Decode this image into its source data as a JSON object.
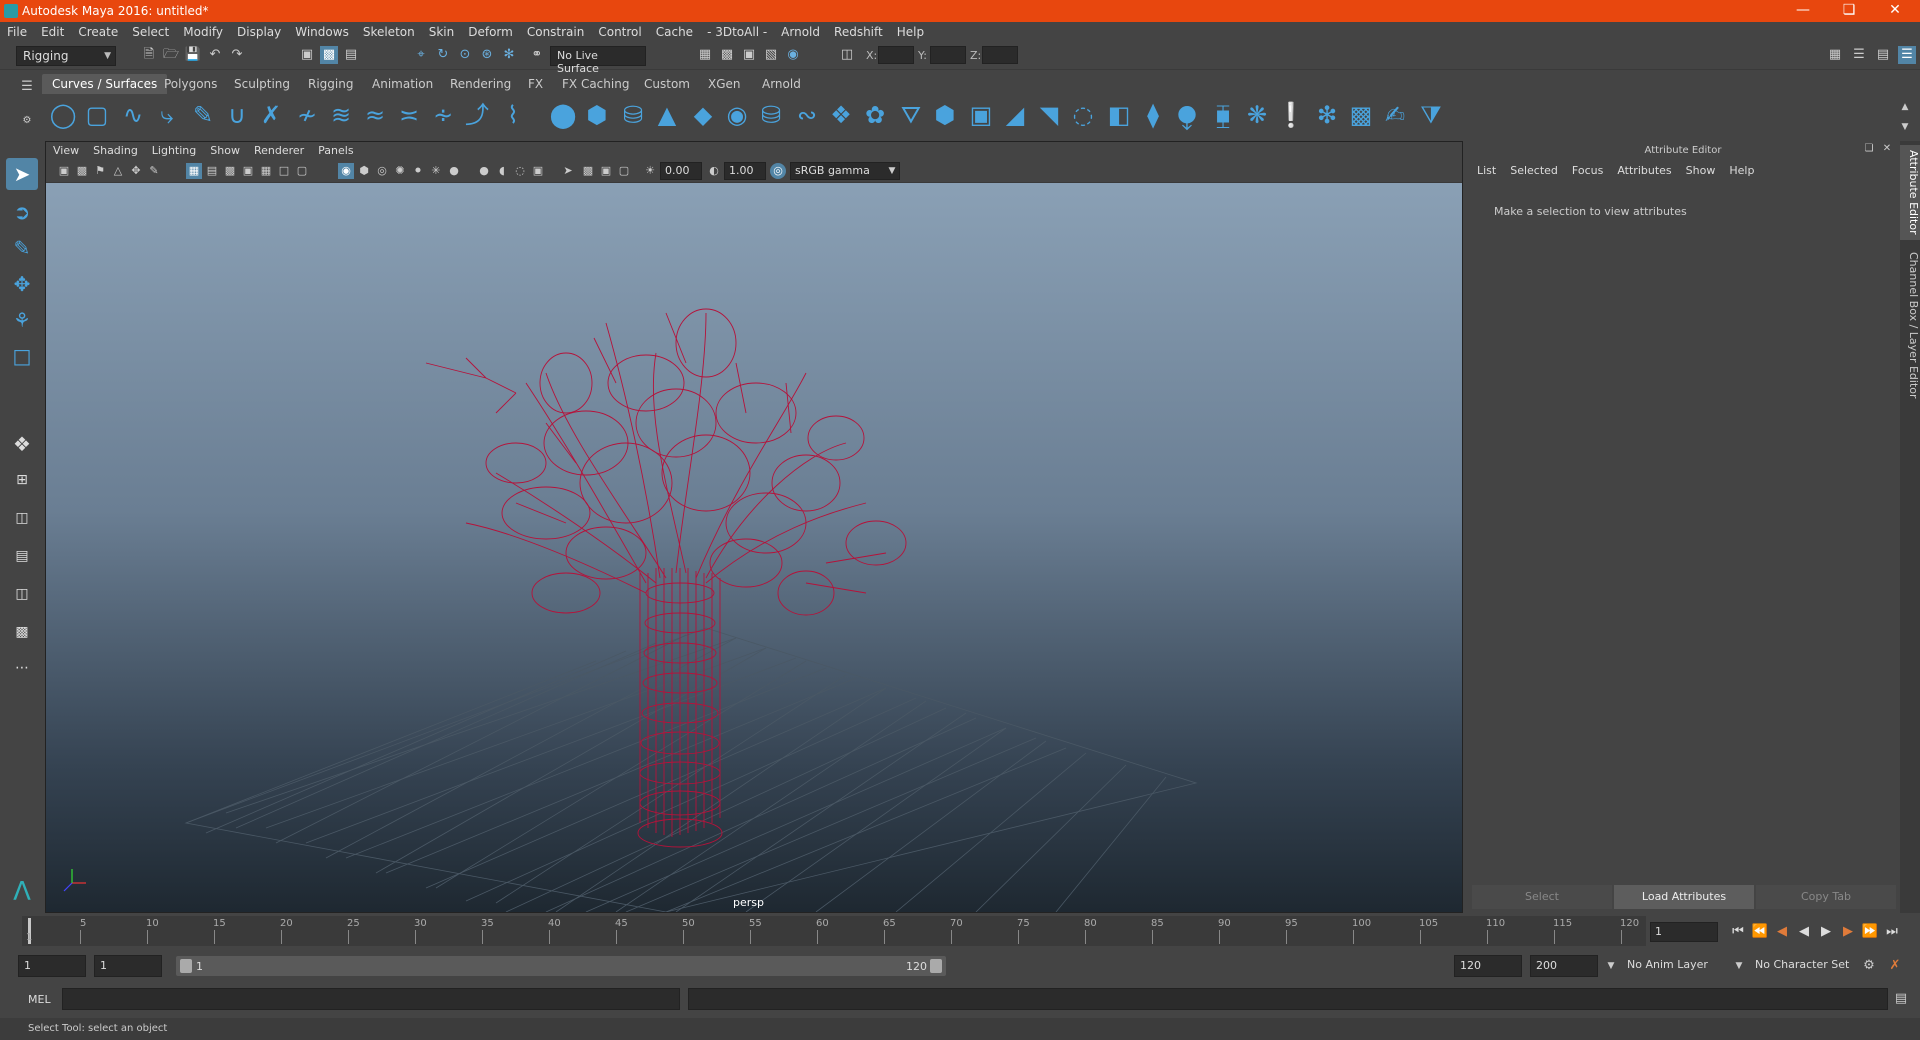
{
  "window": {
    "title": "Autodesk Maya 2016: untitled*"
  },
  "menubar": [
    "File",
    "Edit",
    "Create",
    "Select",
    "Modify",
    "Display",
    "Windows",
    "Skeleton",
    "Skin",
    "Deform",
    "Constrain",
    "Control",
    "Cache",
    "- 3DtoAll -",
    "Arnold",
    "Redshift",
    "Help"
  ],
  "statusline": {
    "menuset": "Rigging",
    "live_surface": "No Live Surface",
    "x_label": "X:",
    "y_label": "Y:",
    "z_label": "Z:"
  },
  "shelf_tabs": [
    "Curves / Surfaces",
    "Polygons",
    "Sculpting",
    "Rigging",
    "Animation",
    "Rendering",
    "FX",
    "FX Caching",
    "Custom",
    "XGen",
    "Arnold"
  ],
  "shelf_active": "Curves / Surfaces",
  "panel_menu": [
    "View",
    "Shading",
    "Lighting",
    "Show",
    "Renderer",
    "Panels"
  ],
  "panel_toolbar": {
    "exposure": "0.00",
    "gamma": "1.00",
    "color_space": "sRGB gamma"
  },
  "viewport": {
    "camera": "persp",
    "wire_color": "#b5123a"
  },
  "attribute_editor": {
    "title": "Attribute Editor",
    "menu": [
      "List",
      "Selected",
      "Focus",
      "Attributes",
      "Show",
      "Help"
    ],
    "message": "Make a selection to view attributes",
    "buttons": {
      "select": "Select",
      "load": "Load Attributes",
      "copy": "Copy Tab"
    }
  },
  "side_tabs": {
    "attr": "Attribute Editor",
    "channel": "Channel Box / Layer Editor"
  },
  "timeline": {
    "ticks": [
      "5",
      "10",
      "15",
      "20",
      "25",
      "30",
      "35",
      "40",
      "45",
      "50",
      "55",
      "60",
      "65",
      "70",
      "75",
      "80",
      "85",
      "90",
      "95",
      "100",
      "105",
      "110",
      "115",
      "120"
    ],
    "start_label": "1",
    "current_frame": "1"
  },
  "range": {
    "start": "1",
    "playback_start": "1",
    "range_start": "1",
    "range_end": "120",
    "playback_end": "120",
    "end": "200",
    "anim_layer": "No Anim Layer",
    "character_set": "No Character Set"
  },
  "command": {
    "label": "MEL"
  },
  "help_line": "Select Tool: select an object"
}
